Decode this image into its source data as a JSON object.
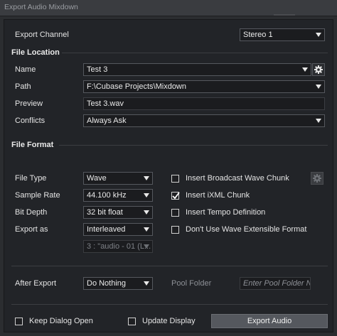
{
  "window": {
    "title": "Export Audio Mixdown"
  },
  "export_channel": {
    "label": "Export Channel",
    "value": "Stereo 1"
  },
  "file_location": {
    "heading": "File Location",
    "name": {
      "label": "Name",
      "value": "Test 3"
    },
    "path": {
      "label": "Path",
      "value": "F:\\Cubase Projects\\Mixdown"
    },
    "preview": {
      "label": "Preview",
      "value": "Test 3.wav"
    },
    "conflicts": {
      "label": "Conflicts",
      "value": "Always Ask"
    }
  },
  "file_format": {
    "heading": "File Format",
    "file_type": {
      "label": "File Type",
      "value": "Wave"
    },
    "sample_rate": {
      "label": "Sample Rate",
      "value": "44.100 kHz"
    },
    "bit_depth": {
      "label": "Bit Depth",
      "value": "32 bit float"
    },
    "export_as": {
      "label": "Export as",
      "value": "Interleaved"
    },
    "channel_naming": {
      "value": "3 : \"audio - 01 (L..."
    },
    "options": [
      {
        "label": "Insert Broadcast Wave Chunk",
        "checked": false
      },
      {
        "label": "Insert iXML Chunk",
        "checked": true
      },
      {
        "label": "Insert Tempo Definition",
        "checked": false
      },
      {
        "label": "Don't Use Wave Extensible Format",
        "checked": false
      }
    ]
  },
  "after_export": {
    "label": "After Export",
    "value": "Do Nothing",
    "pool_folder_label": "Pool Folder",
    "pool_folder_placeholder": "Enter Pool Folder N."
  },
  "footer": {
    "keep_dialog_open": {
      "label": "Keep Dialog Open",
      "checked": false
    },
    "update_display": {
      "label": "Update Display",
      "checked": false
    },
    "export_button": "Export Audio"
  },
  "icons": {
    "name_settings": "gear-icon",
    "broadcast_settings": "gear-icon",
    "dropdown": "chevron-down-icon"
  },
  "colors": {
    "background": "#222428",
    "button": "#55585e"
  }
}
